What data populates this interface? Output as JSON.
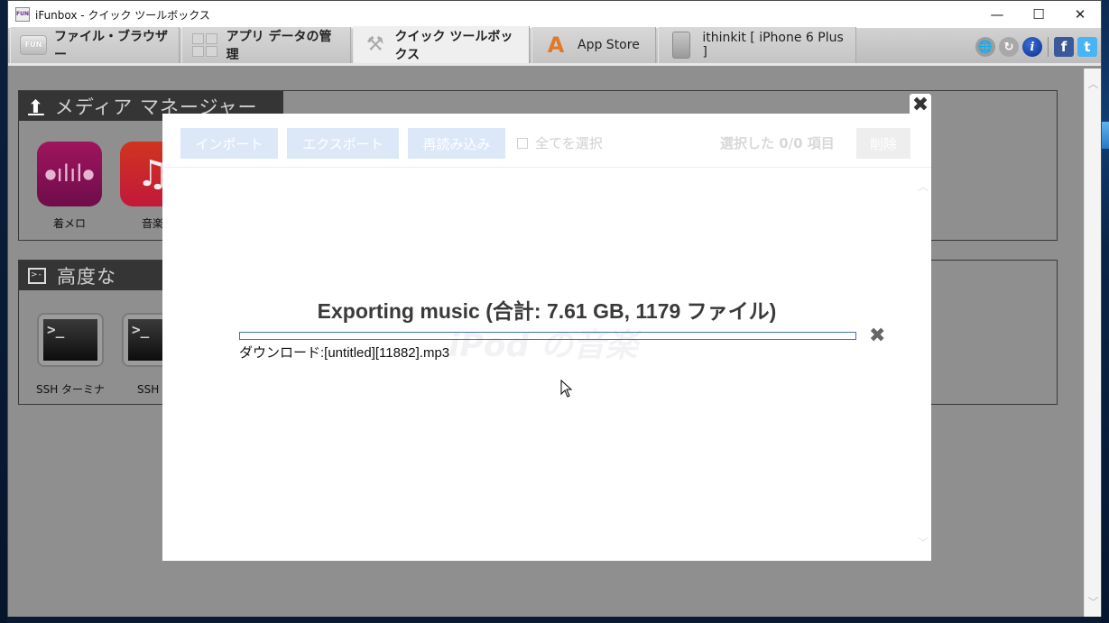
{
  "window": {
    "title": "iFunbox - クイック ツールボックス",
    "app_icon_text": "FUN",
    "controls": {
      "minimize": "—",
      "maximize": "☐",
      "close": "✕"
    }
  },
  "tabs": [
    {
      "label": "ファイル・ブラウザー",
      "icon": "fun-drive-icon",
      "active": false
    },
    {
      "label": "アプリ データの管理",
      "icon": "app-grid-icon",
      "active": false
    },
    {
      "label": "クイック ツールボックス",
      "icon": "toolbox-icon",
      "active": true
    },
    {
      "label": "App Store",
      "icon": "app-store-icon",
      "active": false
    },
    {
      "label": "ithinkit [ iPhone 6 Plus ]",
      "icon": "iphone-icon",
      "active": false
    }
  ],
  "toolbar_icons": {
    "globe": "🌐",
    "refresh": "↻",
    "info": "i",
    "facebook": "f",
    "twitter": "t"
  },
  "panels": {
    "media": {
      "title": "メディア マネージャー",
      "icon": "upload-icon",
      "items": [
        {
          "label": "着メロ",
          "icon": "ringtone-icon"
        },
        {
          "label": "音楽",
          "icon": "music-icon"
        }
      ]
    },
    "advanced": {
      "title": "高度な",
      "icon": "terminal-icon",
      "items": [
        {
          "label": "SSH ターミナ",
          "icon": "terminal-icon"
        },
        {
          "label": "SSH の",
          "icon": "terminal-icon"
        }
      ]
    }
  },
  "modal": {
    "toolbar": {
      "import_label": "インポート",
      "export_label": "エクスポート",
      "reload_label": "再読み込み",
      "select_all_label": "全てを選択",
      "select_all_checked": false,
      "selected_count": "選択した 0/0 項目",
      "delete_label": "削除"
    },
    "watermark": "iPod の音楽",
    "export": {
      "title": "Exporting music (合計: 7.61 GB, 1179 ファイル)",
      "progress_percent": 0,
      "status": "ダウンロード:[untitled][11882].mp3"
    },
    "close_glyph": "✖",
    "cancel_glyph": "✖"
  },
  "colors": {
    "accent": "#3d74b0",
    "button_disabled": "#dce8f8",
    "overlay": "#8f8f8f"
  }
}
